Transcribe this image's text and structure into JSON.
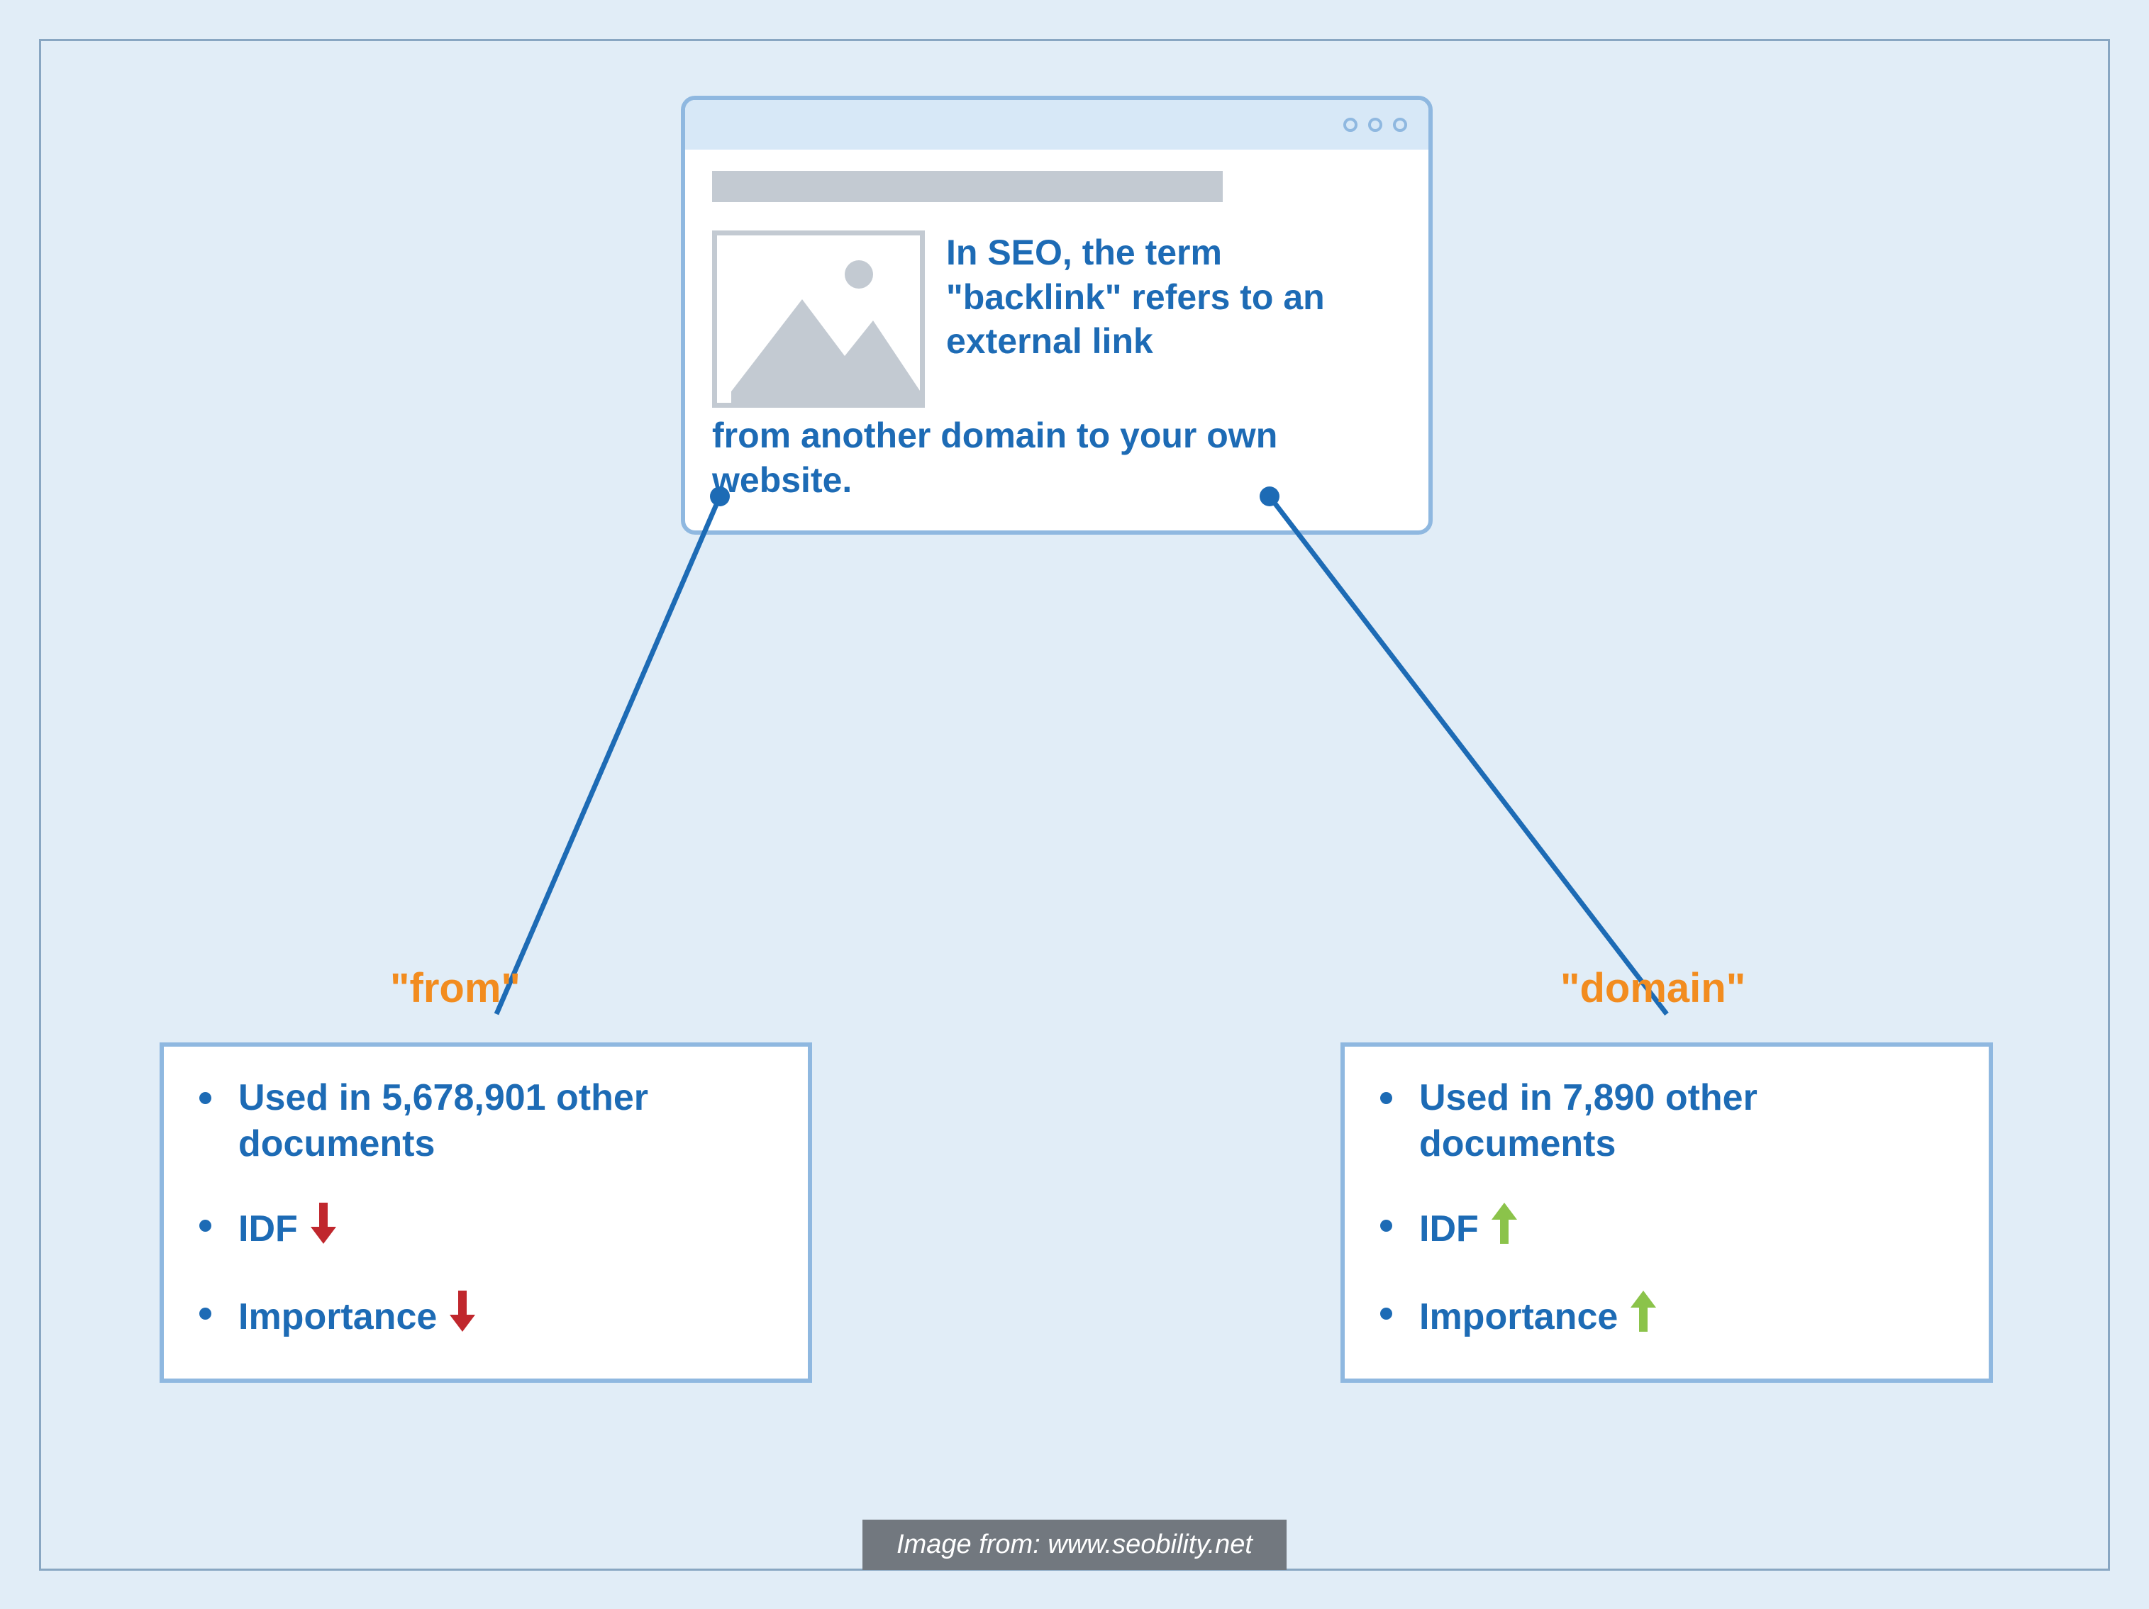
{
  "browser": {
    "sentence_part1": "In SEO, the term \"backlink\" refers to an external link",
    "highlight_from": "from",
    "sentence_mid1": " another ",
    "highlight_domain": "domain",
    "sentence_part2": " to your own website."
  },
  "connectors": {
    "from_term_label": "\"from\"",
    "domain_term_label": "\"domain\""
  },
  "from_box": {
    "usage": "Used in 5,678,901 other documents",
    "idf_label": "IDF",
    "idf_direction": "down",
    "importance_label": "Importance",
    "importance_direction": "down"
  },
  "domain_box": {
    "usage": "Used in 7,890 other documents",
    "idf_label": "IDF",
    "idf_direction": "up",
    "importance_label": "Importance",
    "importance_direction": "up"
  },
  "caption": "Image from: www.seobility.net",
  "colors": {
    "bg": "#e1edf7",
    "stroke": "#8fb8e0",
    "text_blue": "#1d6bb5",
    "highlight_orange": "#f28c1f",
    "arrow_down": "#c0272d",
    "arrow_up": "#8bc34a"
  }
}
